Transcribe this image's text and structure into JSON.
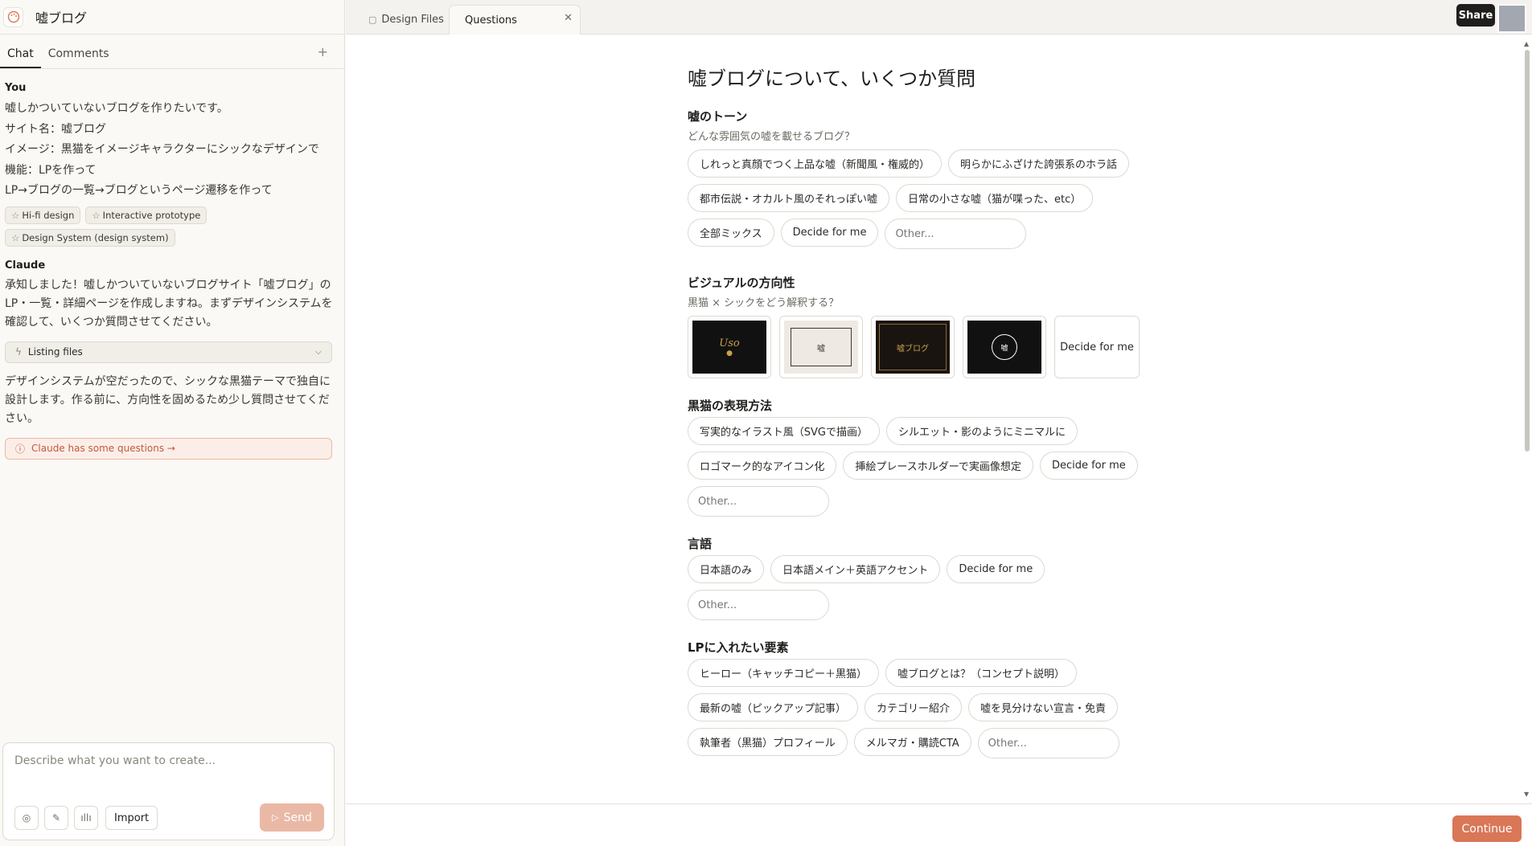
{
  "project": {
    "title": "嘘ブログ",
    "logo_icon": "palette-icon"
  },
  "left_tabs": [
    "Chat",
    "Comments"
  ],
  "chat": {
    "you_label": "You",
    "you_lines": [
      "嘘しかついていないブログを作りたいです。",
      " サイト名：嘘ブログ",
      " イメージ：黒猫をイメージキャラクターにシックなデザインで",
      " 機能：LPを作って",
      "LP→ブログの一覧→ブログというページ遷移を作って"
    ],
    "chips": [
      "Hi-fi design",
      "Interactive prototype",
      "Design System (design system)"
    ],
    "claude_label": "Claude",
    "claude_text_1": "承知しました！嘘しかついていないブログサイト「嘘ブログ」のLP・一覧・詳細ページを作成しますね。まずデザインシステムを確認して、いくつか質問させてください。",
    "listing_label": "Listing files",
    "claude_text_2": "デザインシステムが空だったので、シックな黒猫テーマで独自に設計します。作る前に、方向性を固めるため少し質問させてください。",
    "questions_pill": "Claude has some questions →"
  },
  "composer": {
    "placeholder": "Describe what you want to create...",
    "import_label": "Import",
    "send_label": "Send"
  },
  "tabs": {
    "design_files": "Design Files",
    "questions": "Questions"
  },
  "share_label": "Share",
  "questions": {
    "title": "嘘ブログについて、いくつか質問",
    "tone": {
      "heading": "嘘のトーン",
      "sub": "どんな雰囲気の嘘を載せるブログ？",
      "options": [
        "しれっと真顔でつく上品な嘘（新聞風・権威的）",
        "明らかにふざけた誇張系のホラ話",
        "都市伝説・オカルト風のそれっぽい嘘",
        "日常の小さな嘘（猫が喋った、etc）",
        "全部ミックス",
        "Decide for me"
      ],
      "other": "Other..."
    },
    "visual": {
      "heading": "ビジュアルの方向性",
      "sub": "黒猫 × シックをどう解釈する？",
      "card1": "Uso",
      "card2": "嘘",
      "card3": "嘘ブログ",
      "card4": "嘘",
      "decide": "Decide for me"
    },
    "cat": {
      "heading": "黒猫の表現方法",
      "options": [
        "写実的なイラスト風（SVGで描画）",
        "シルエット・影のようにミニマルに",
        "ロゴマーク的なアイコン化",
        "挿絵プレースホルダーで実画像想定",
        "Decide for me"
      ],
      "other": "Other..."
    },
    "lang": {
      "heading": "言語",
      "options": [
        "日本語のみ",
        "日本語メイン＋英語アクセント",
        "Decide for me"
      ],
      "other": "Other..."
    },
    "lp": {
      "heading": "LPに入れたい要素",
      "options": [
        "ヒーロー（キャッチコピー＋黒猫）",
        "嘘ブログとは？（コンセプト説明）",
        "最新の嘘（ピックアップ記事）",
        "カテゴリー紹介",
        "嘘を見分けない宣言・免責",
        "執筆者（黒猫）プロフィール",
        "メルマガ・購読CTA"
      ],
      "other": "Other..."
    }
  },
  "continue_label": "Continue",
  "colors": {
    "accent": "#d97757",
    "send_disabled": "#eab9a6",
    "dark_card": "#111111",
    "gold": "#c9a24a"
  }
}
